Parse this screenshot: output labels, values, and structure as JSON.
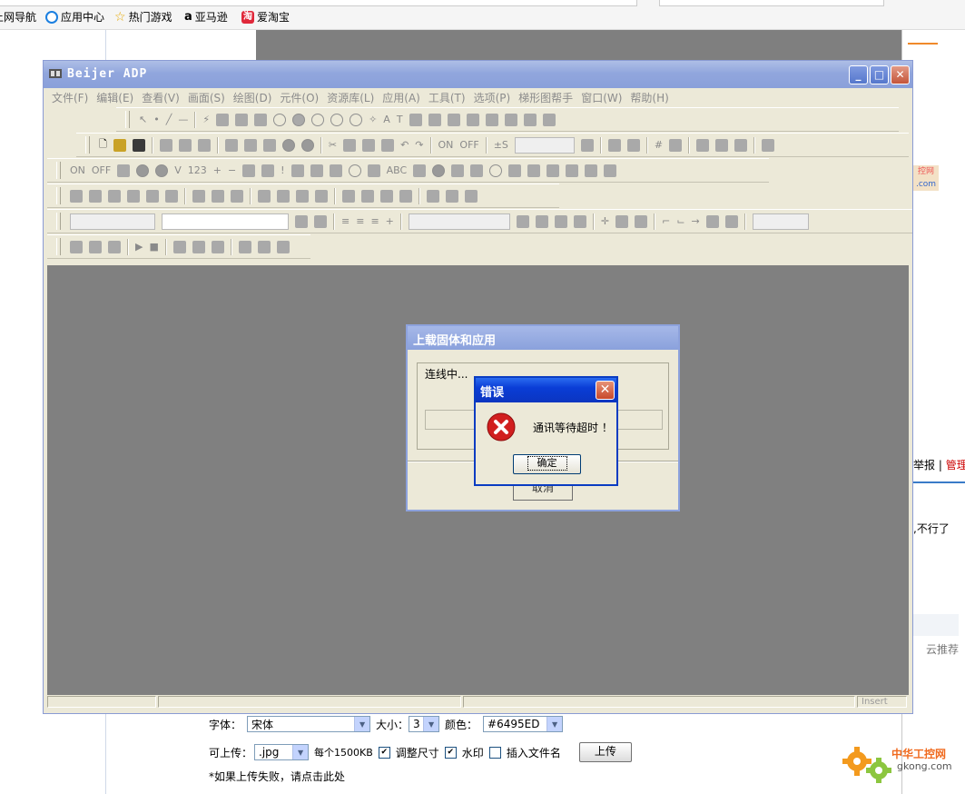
{
  "bookmarks": [
    {
      "label": "上网导航",
      "icon": "globe-icon"
    },
    {
      "label": "应用中心",
      "icon": "app-center-icon"
    },
    {
      "label": "热门游戏",
      "icon": "star-icon"
    },
    {
      "label": "亚马逊",
      "icon": "amazon-icon"
    },
    {
      "label": "爱淘宝",
      "icon": "taobao-icon"
    }
  ],
  "right_panel": {
    "report": "举报",
    "manage": "管理",
    "snippet": ",不行了",
    "recommend": "云推荐",
    "ad_text": "控网"
  },
  "editor": {
    "font_label": "字体：",
    "font_value": "宋体",
    "size_label": "大小：",
    "size_value": "3",
    "color_label": "颜色：",
    "color_value": "#6495ED",
    "upload_label": "可上传：",
    "upload_type": ".jpg",
    "per_size": "每个1500KB",
    "opt_resize": "调整尺寸",
    "opt_watermark": "水印",
    "opt_insert": "插入文件名",
    "upload_button": "上传",
    "fail_note": "*如果上传失败，请点击此处"
  },
  "logo": {
    "title": "中华工控网",
    "domain": "gkong.com"
  },
  "app": {
    "title": "Beijer ADP",
    "menu": [
      "文件(F)",
      "编辑(E)",
      "查看(V)",
      "画面(S)",
      "绘图(D)",
      "元件(O)",
      "资源库(L)",
      "应用(A)",
      "工具(T)",
      "选项(P)",
      "梯形图帮手",
      "窗口(W)",
      "帮助(H)"
    ],
    "status_insert": "Insert",
    "toolbar_text": {
      "on": "ON",
      "off": "OFF",
      "v": "V",
      "n123": "123",
      "plus": "+",
      "minus": "−",
      "bang": "!",
      "pm": "±S",
      "abc": "ABC"
    }
  },
  "upload_dialog": {
    "title": "上载固体和应用",
    "status": "连线中...",
    "cancel": "取消"
  },
  "error_dialog": {
    "title": "错误",
    "message": "通讯等待超时 ！",
    "ok": "确定"
  },
  "colors": {
    "title_blue": "#0a3dd6",
    "error_red": "#d11f1f",
    "workspace_gray": "#808080"
  }
}
